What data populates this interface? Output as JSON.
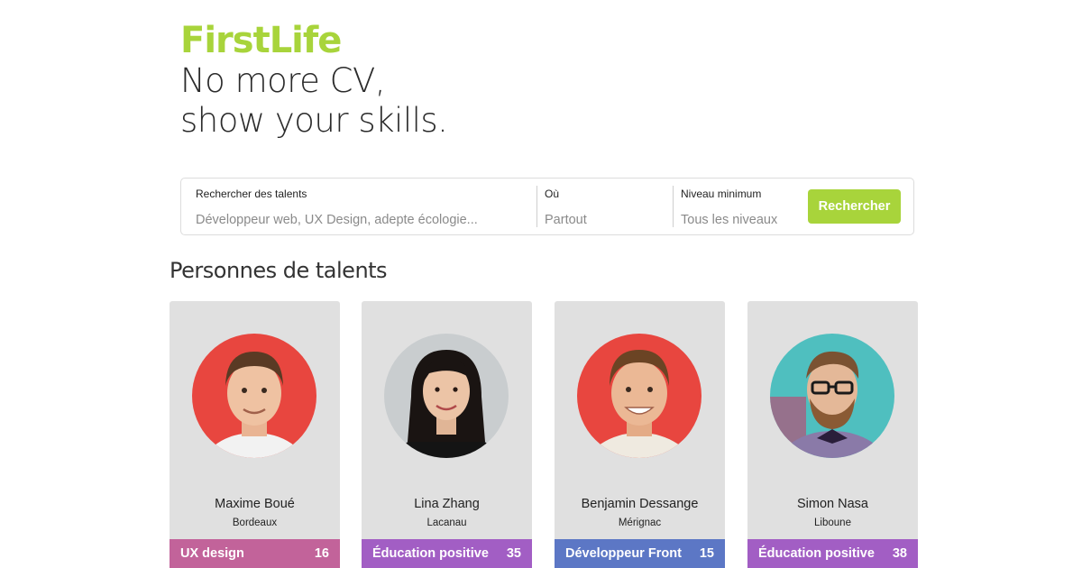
{
  "hero": {
    "brand": "FirstLife",
    "brand_color": "#a8d43b",
    "tagline_line1": "No more CV,",
    "tagline_line2": "show your skills."
  },
  "search": {
    "talent_label": "Rechercher des talents",
    "talent_placeholder": "Développeur web, UX Design, adepte écologie...",
    "where_label": "Où",
    "where_placeholder": "Partout",
    "level_label": "Niveau minimum",
    "level_placeholder": "Tous les niveaux",
    "button_label": "Rechercher"
  },
  "section": {
    "title": "Personnes de talents"
  },
  "cards": [
    {
      "name": "Maxime Boué",
      "city": "Bordeaux",
      "skill": "UX design",
      "count": "16",
      "skill_color": "#c2639a",
      "avatar_bg": "#e8463f"
    },
    {
      "name": "Lina Zhang",
      "city": "Lacanau",
      "skill": "Éducation positive",
      "count": "35",
      "skill_color": "#a25ec4",
      "avatar_bg": "#c9cdcf"
    },
    {
      "name": "Benjamin Dessange",
      "city": "Mérignac",
      "skill": "Développeur Front",
      "count": "15",
      "skill_color": "#5c77c5",
      "avatar_bg": "#e8463f"
    },
    {
      "name": "Simon Nasa",
      "city": "Liboune",
      "skill": "Éducation positive",
      "count": "38",
      "skill_color": "#a25ec4",
      "avatar_bg": "#4fbfbf"
    }
  ]
}
